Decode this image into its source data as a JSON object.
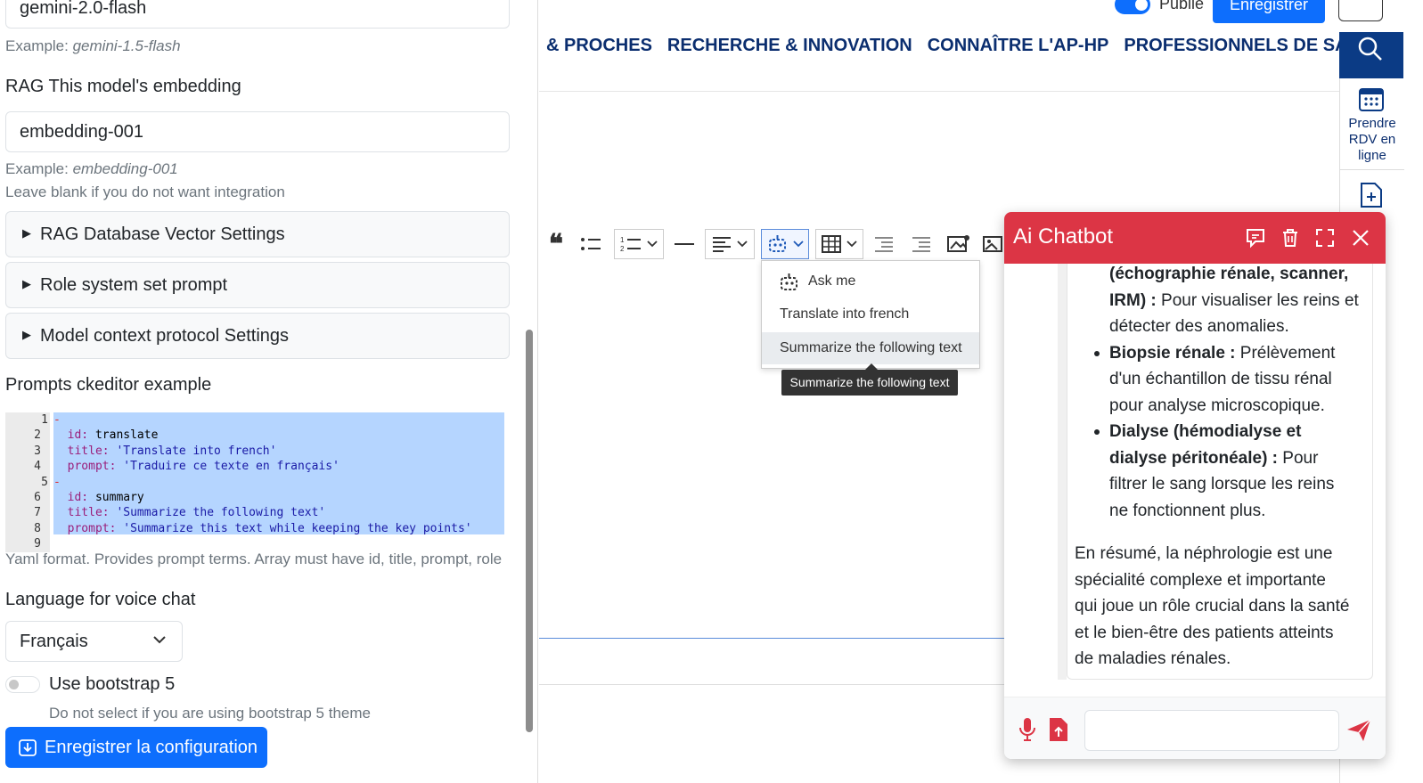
{
  "left": {
    "model_value": "gemini-2.0-flash",
    "model_example_prefix": "Example: ",
    "model_example": "gemini-1.5-flash",
    "embedding_label": "RAG This model's embedding",
    "embedding_value": "embedding-001",
    "embedding_example_prefix": "Example: ",
    "embedding_example": "embedding-001",
    "embedding_help": "Leave blank if you do not want integration",
    "details": [
      "RAG Database Vector Settings",
      "Role system set prompt",
      "Model context protocol Settings"
    ],
    "prompts_label": "Prompts ckeditor example",
    "code_lines": [
      {
        "n": "1",
        "fold": true,
        "text": "-"
      },
      {
        "n": "2",
        "key": "  id:",
        "val": " translate"
      },
      {
        "n": "3",
        "key": "  title:",
        "str": " 'Translate into french'"
      },
      {
        "n": "4",
        "key": "  prompt:",
        "str": " 'Traduire ce texte en français'"
      },
      {
        "n": "5",
        "fold": true,
        "text": "-"
      },
      {
        "n": "6",
        "key": "  id:",
        "val": " summary"
      },
      {
        "n": "7",
        "key": "  title:",
        "str": " 'Summarize the following text'"
      },
      {
        "n": "8",
        "key": "  prompt:",
        "str": " 'Summarize this text while keeping the key points'"
      },
      {
        "n": "9",
        "text": ""
      }
    ],
    "yaml_help": "Yaml format. Provides prompt terms. Array must have id, title, prompt, role",
    "voice_label": "Language for voice chat",
    "voice_value": "Français",
    "bootstrap_label": "Use bootstrap 5",
    "bootstrap_help": "Do not select if you are using bootstrap 5 theme",
    "save_button": "Enregistrer la configuration"
  },
  "right": {
    "publie": "Publié",
    "enregistrer": "Enregistrer",
    "nav": [
      "& PROCHES",
      "RECHERCHE & INNOVATION",
      "CONNAÎTRE L'AP-HP",
      "PROFESSIONNELS DE SANTÉ"
    ],
    "rdv": [
      "Prendre",
      "RDV en",
      "ligne"
    ],
    "menu": [
      "Ask me",
      "Translate into french",
      "Summarize the following text"
    ],
    "tooltip": "Summarize the following text"
  },
  "chat": {
    "title": "Ai Chatbot",
    "lines": [
      {
        "b": "(échographie rénale, scanner,",
        "t": ""
      },
      {
        "b": "IRM) :",
        "t": " Pour visualiser les reins et"
      },
      {
        "b": "",
        "t": "détecter des anomalies."
      },
      {
        "b": "Biopsie rénale :",
        "t": " Prélèvement"
      },
      {
        "b": "",
        "t": "d'un échantillon de tissu rénal"
      },
      {
        "b": "",
        "t": "pour analyse microscopique."
      },
      {
        "b": "Dialyse (hémodialyse et",
        "t": ""
      },
      {
        "b": "dialyse péritonéale) :",
        "t": " Pour"
      },
      {
        "b": "",
        "t": "filtrer le sang lorsque les reins"
      },
      {
        "b": "",
        "t": "ne fonctionnent plus."
      }
    ],
    "summary": [
      "En résumé, la néphrologie est une",
      "spécialité complexe et importante",
      "qui joue un rôle crucial dans la santé",
      "et le bien-être des patients atteints",
      "de maladies rénales."
    ]
  }
}
